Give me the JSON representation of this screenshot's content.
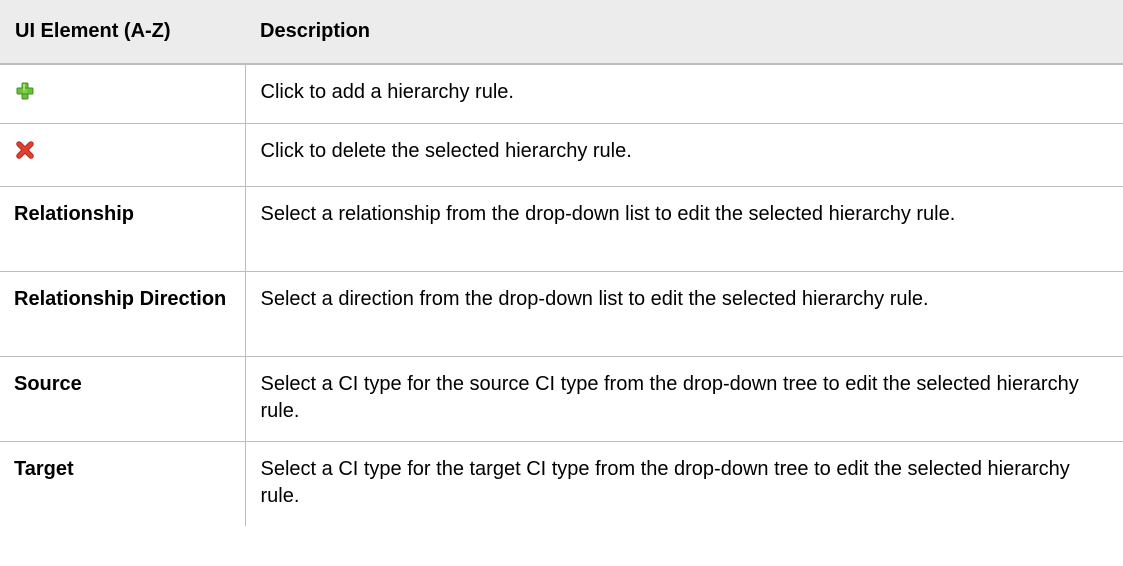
{
  "table": {
    "headers": {
      "element": "UI Element (A-Z)",
      "description": "Description"
    },
    "rows": [
      {
        "element_icon": "add-icon",
        "element": "",
        "description": "Click to add a hierarchy rule."
      },
      {
        "element_icon": "delete-icon",
        "element": "",
        "description": "Click to delete the selected hierarchy rule."
      },
      {
        "element": "Relationship",
        "description": "Select a relationship from the drop-down list to edit the selected hierarchy rule."
      },
      {
        "element": "Relationship Direction",
        "description": "Select a direction from the drop-down list to edit the selected hierarchy rule."
      },
      {
        "element": "Source",
        "description": "Select a CI type for the source CI type from the drop-down tree to edit the selected hierarchy rule."
      },
      {
        "element": "Target",
        "description": "Select a CI type for the target CI type from the drop-down tree to edit the selected hierarchy rule."
      }
    ]
  },
  "colors": {
    "header_background": "#ececec",
    "border": "#bcbcbc",
    "add_icon": "#6cbf3a",
    "delete_icon": "#e5402f"
  }
}
